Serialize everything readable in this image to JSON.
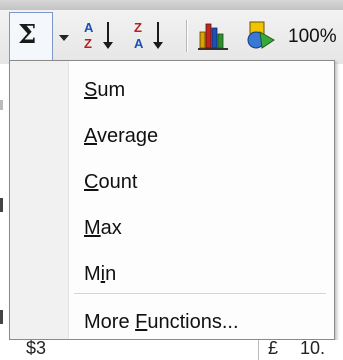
{
  "toolbar": {
    "autosum_symbol": "Σ",
    "sort_ascending_icon": "sort-ascending-icon",
    "sort_descending_icon": "sort-descending-icon",
    "chart_wizard_icon": "chart-wizard-icon",
    "drawing_icon": "drawing-icon",
    "zoom": "100%"
  },
  "menu": {
    "items": [
      {
        "prefix": "",
        "accel": "S",
        "rest": "um"
      },
      {
        "prefix": "",
        "accel": "A",
        "rest": "verage"
      },
      {
        "prefix": "",
        "accel": "C",
        "rest": "ount"
      },
      {
        "prefix": "",
        "accel": "M",
        "rest": "ax"
      },
      {
        "prefix": "M",
        "accel": "i",
        "rest": "n"
      },
      {
        "prefix": "More ",
        "accel": "F",
        "rest": "unctions..."
      }
    ]
  },
  "sheet": {
    "cell_left": "$3",
    "cell_right_symbol": "£",
    "cell_right_value": "10."
  },
  "colors": {
    "highlight_border": "#7c98c8",
    "menu_bg": "#fdfdfd",
    "gutter_bg": "#f1f1f1"
  }
}
